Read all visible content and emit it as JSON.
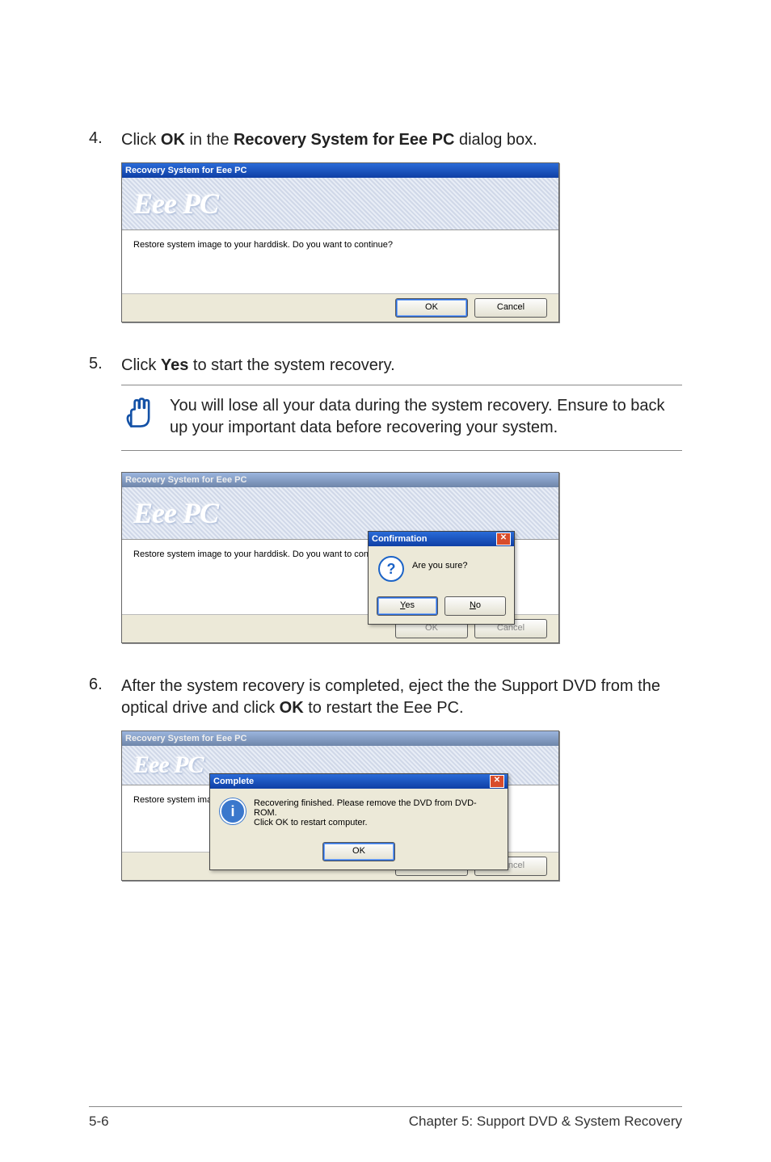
{
  "steps": {
    "s4": {
      "num": "4.",
      "pre": "Click ",
      "bold1": "OK",
      "mid": " in the ",
      "bold2": "Recovery System for Eee PC",
      "post": " dialog box."
    },
    "s5": {
      "num": "5.",
      "pre": "Click ",
      "bold1": "Yes",
      "post": " to start the system recovery."
    },
    "s6": {
      "num": "6.",
      "text_a": "After the system recovery is completed, eject the the Support DVD from the optical drive and click ",
      "bold": "OK",
      "text_b": " to restart the Eee PC."
    }
  },
  "note": "You will lose all your data during the system recovery. Ensure to back up your important data before recovering your system.",
  "dlg": {
    "title": "Recovery System for Eee PC",
    "logo_text": "Eee PC",
    "body_text": "Restore system image to your harddisk. Do you want to continue?",
    "body_text_short": "Restore system ima",
    "ok": "OK",
    "cancel": "Cancel"
  },
  "confirm": {
    "title": "Confirmation",
    "text": "Are you sure?",
    "yes": "Yes",
    "no": "No"
  },
  "complete": {
    "title": "Complete",
    "line1": "Recovering finished. Please remove the DVD from DVD-ROM.",
    "line2": "Click OK to restart computer.",
    "ok": "OK"
  },
  "footer": {
    "page": "5-6",
    "chapter": "Chapter 5: Support DVD & System Recovery"
  }
}
